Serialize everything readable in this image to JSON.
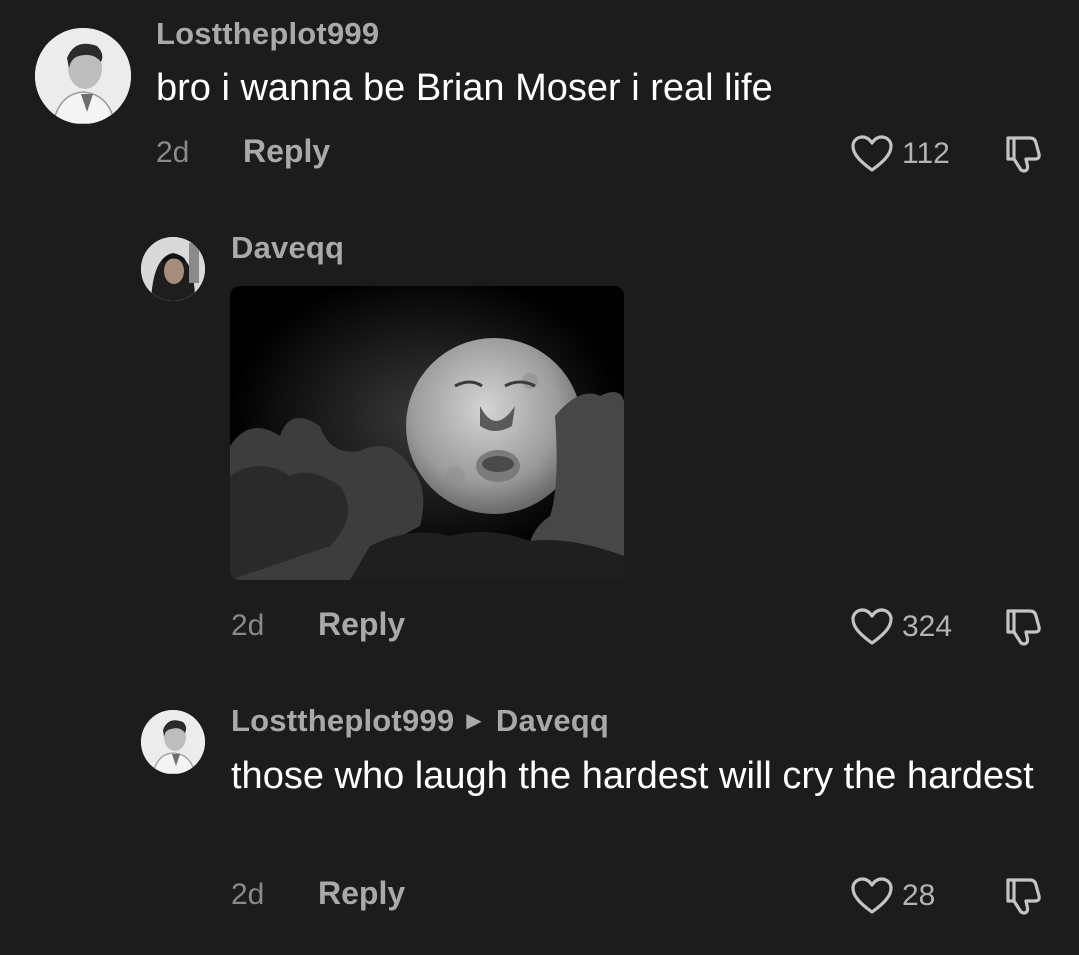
{
  "comments": [
    {
      "username": "Losttheplot999",
      "text": "bro i wanna be Brian Moser i real life",
      "age": "2d",
      "reply_label": "Reply",
      "likes": "112"
    },
    {
      "username": "Daveqq",
      "age": "2d",
      "reply_label": "Reply",
      "likes": "324"
    },
    {
      "username": "Losttheplot999",
      "reply_to": "Daveqq",
      "text": "those who laugh the hardest will cry the hardest",
      "age": "2d",
      "reply_label": "Reply",
      "likes": "28"
    }
  ],
  "icons": {
    "like": "heart-outline-icon",
    "dislike": "thumbs-down-icon",
    "reply_arrow": "caret-right-icon"
  },
  "colors": {
    "background": "#1c1c1c",
    "primary_text": "#ffffff",
    "secondary_text": "#a9a9a9",
    "muted_text": "#8a8a8a"
  }
}
